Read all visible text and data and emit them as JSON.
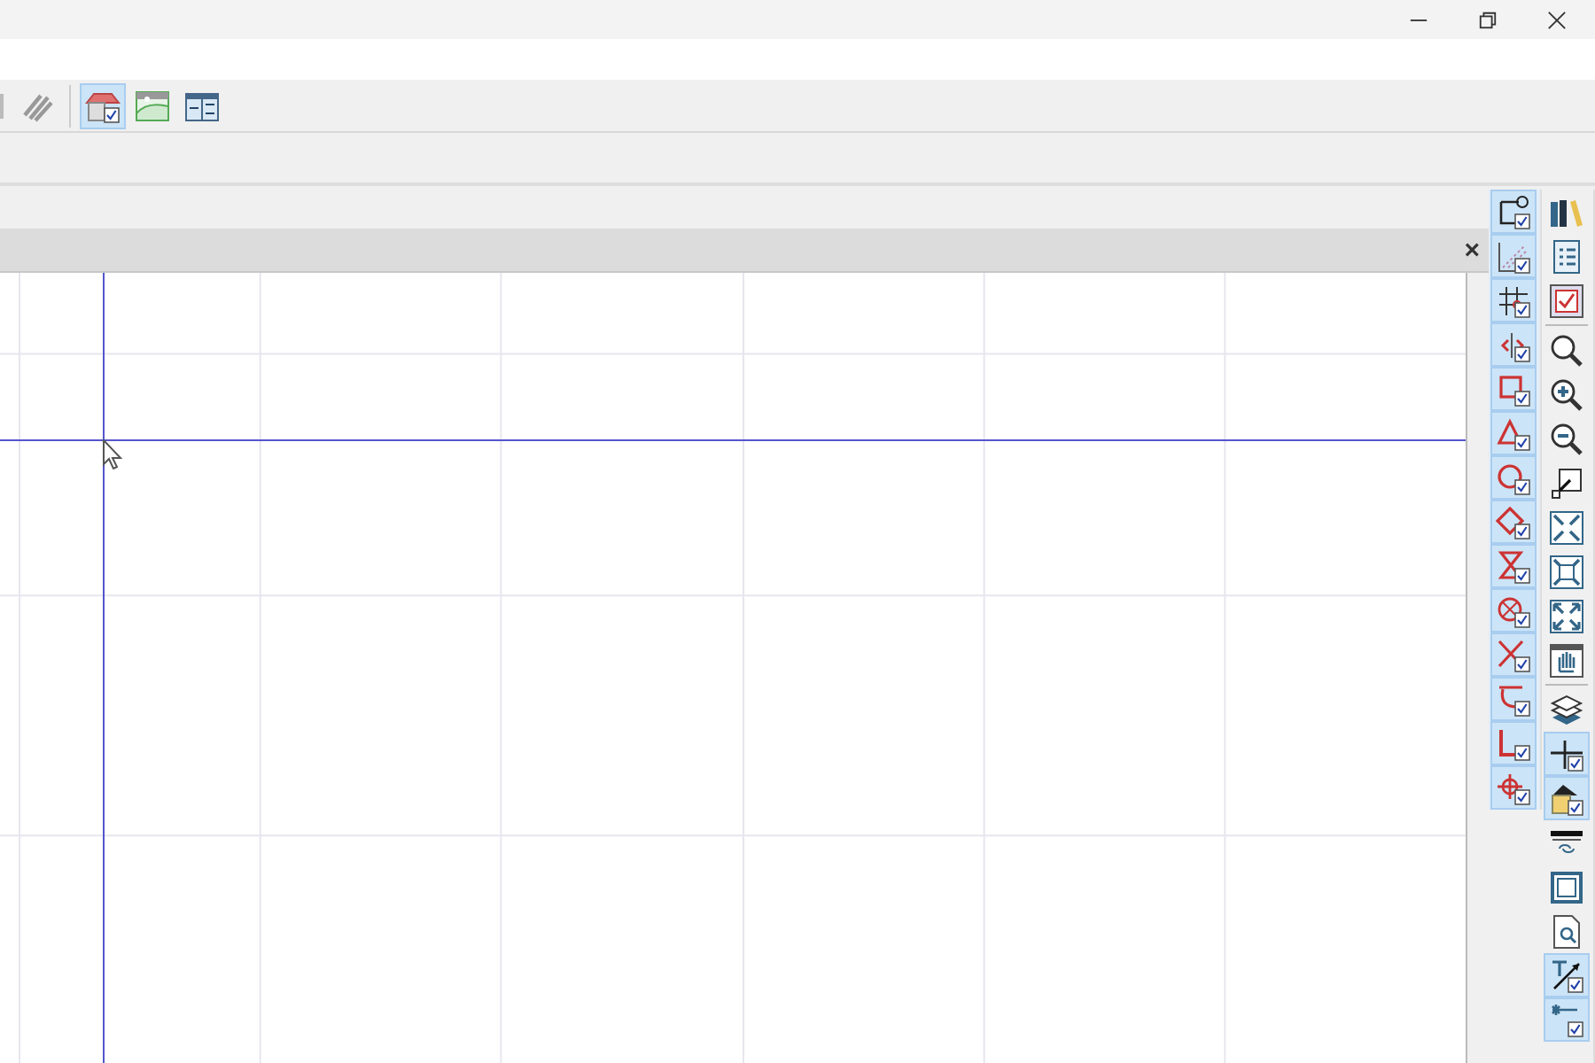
{
  "top_toolbar": {
    "buttons": [
      {
        "kind": "hatch",
        "selected": false
      },
      {
        "kind": "house",
        "selected": true
      },
      {
        "kind": "picture",
        "selected": false
      },
      {
        "kind": "layout",
        "selected": false
      }
    ]
  },
  "drawing_panel": {
    "close": "×"
  },
  "side_toolbar_left": {
    "buttons": [
      {
        "kind": "corner",
        "selected": true
      },
      {
        "kind": "hatch-lines",
        "selected": true
      },
      {
        "kind": "grid",
        "selected": true
      },
      {
        "kind": "split",
        "selected": true
      },
      {
        "kind": "square",
        "selected": true
      },
      {
        "kind": "triangle",
        "selected": true
      },
      {
        "kind": "circle",
        "selected": true
      },
      {
        "kind": "diamond",
        "selected": true
      },
      {
        "kind": "hourglass",
        "selected": true
      },
      {
        "kind": "circle-x",
        "selected": true
      },
      {
        "kind": "cross",
        "selected": true
      },
      {
        "kind": "arc-bar",
        "selected": true
      },
      {
        "kind": "step",
        "selected": true
      },
      {
        "kind": "target",
        "selected": true
      }
    ]
  },
  "side_toolbar_right": {
    "buttons": [
      {
        "kind": "books",
        "selected": false
      },
      {
        "kind": "list",
        "selected": false
      },
      {
        "kind": "check-form",
        "selected": false
      },
      {
        "kind": "zoom",
        "selected": false
      },
      {
        "kind": "zoom-in",
        "selected": false
      },
      {
        "kind": "zoom-out",
        "selected": false
      },
      {
        "kind": "zoom-box",
        "selected": false
      },
      {
        "kind": "arrows-in",
        "selected": false
      },
      {
        "kind": "arrows-out",
        "selected": false
      },
      {
        "kind": "fullscreen",
        "selected": false
      },
      {
        "kind": "hand",
        "selected": false
      },
      {
        "kind": "layers",
        "selected": false
      },
      {
        "kind": "plus-line",
        "selected": true
      },
      {
        "kind": "house-box",
        "selected": true
      },
      {
        "kind": "bar-swap",
        "selected": false
      },
      {
        "kind": "frame",
        "selected": false
      },
      {
        "kind": "page-search",
        "selected": false
      },
      {
        "kind": "text-arrow",
        "selected": true
      },
      {
        "kind": "dimension",
        "selected": true
      }
    ]
  }
}
